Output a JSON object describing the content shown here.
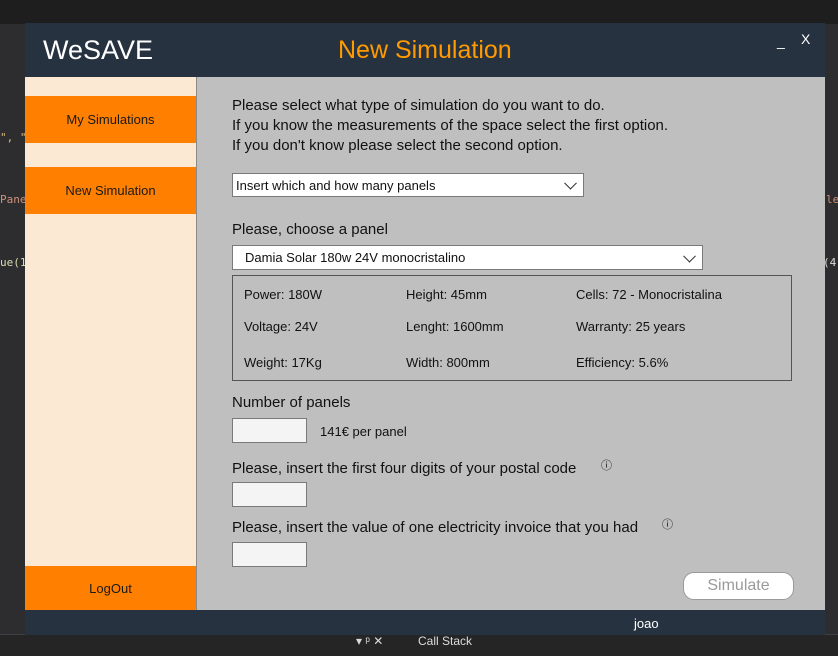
{
  "ide": {
    "frag_left_1": "\", \"",
    "frag_left_2": "Pane",
    "frag_left_3": "ue(1",
    "frag_right_1": "le",
    "frag_right_2": "(4)",
    "bottom_tools": "▾ ᵖ ✕",
    "call_stack": "Call Stack"
  },
  "app": {
    "brand": "WeSAVE",
    "title": "New Simulation",
    "minimize": "_",
    "close": "X",
    "accent": "#ff7f00",
    "title_color": "#ff9a00"
  },
  "sidebar": {
    "my_simulations": "My Simulations",
    "new_simulation": "New Simulation",
    "logout": "LogOut"
  },
  "intro": [
    "Please select what type of simulation do you want to do.",
    "If you know the measurements of the space select the first option.",
    "If you don't know please select the second option."
  ],
  "simulation_type": {
    "selected": "Insert which and how many panels"
  },
  "panel": {
    "label": "Please, choose a panel",
    "selected": "Damia Solar 180w 24V monocristalino",
    "specs": {
      "power": "Power: 180W",
      "height": "Height: 45mm",
      "cells": "Cells: 72 - Monocristalina",
      "voltage": "Voltage: 24V",
      "length": "Lenght: 1600mm",
      "warranty": "Warranty: 25 years",
      "weight": "Weight: 17Kg",
      "width": "Width: 800mm",
      "efficiency": "Efficiency: 5.6%"
    }
  },
  "panels_count": {
    "label": "Number of panels",
    "value": "",
    "price": "141€ per panel"
  },
  "postal_code": {
    "label": "Please, insert the first four digits of your postal code",
    "value": ""
  },
  "invoice": {
    "label": "Please, insert the value of one electricity invoice that you had",
    "value": ""
  },
  "info_icon": "ⓘ",
  "simulate_button": "Simulate",
  "status": {
    "username": "joao"
  }
}
